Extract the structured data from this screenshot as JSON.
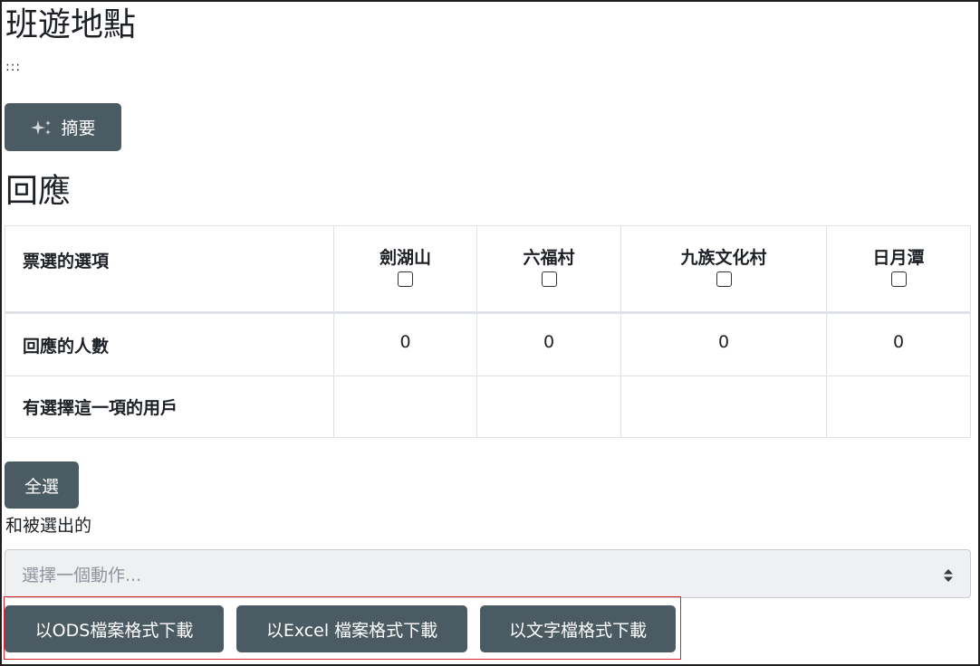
{
  "page": {
    "title": "班遊地點",
    "dots": ":::",
    "summary_label": "摘要"
  },
  "responses": {
    "title": "回應",
    "header_label": "票選的選項",
    "options": [
      "劍湖山",
      "六福村",
      "九族文化村",
      "日月潭"
    ],
    "count_label": "回應的人數",
    "counts": [
      "0",
      "0",
      "0",
      "0"
    ],
    "users_label": "有選擇這一項的用戶"
  },
  "actions": {
    "select_all": "全選",
    "and_selected": "和被選出的",
    "action_placeholder": "選擇一個動作..."
  },
  "downloads": {
    "ods": "以ODS檔案格式下載",
    "excel": "以Excel 檔案格式下載",
    "text": "以文字檔格式下載"
  },
  "colors": {
    "button_bg": "#4a5b63",
    "highlight_border": "#d9242a"
  }
}
